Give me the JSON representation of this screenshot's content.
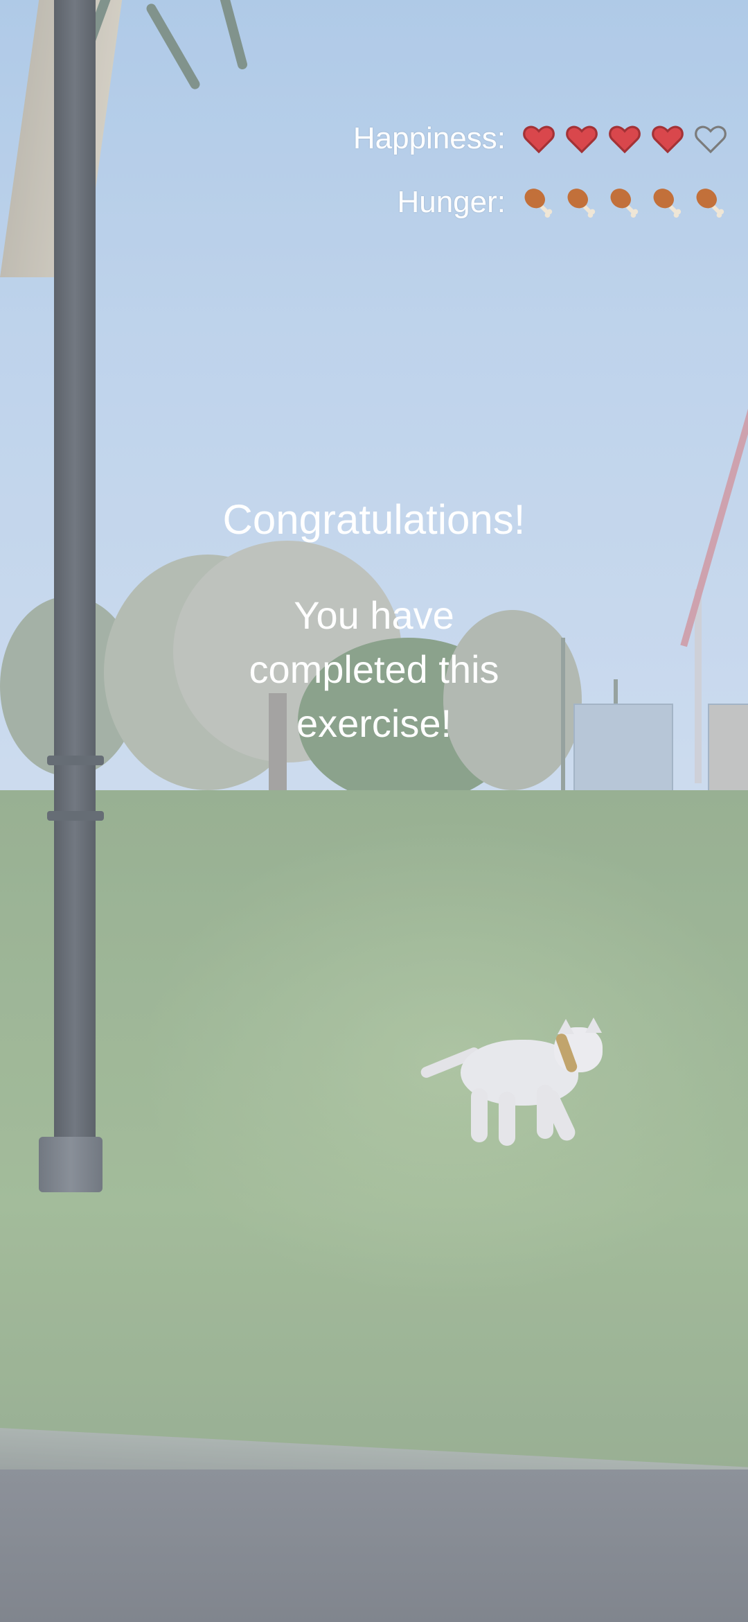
{
  "hud": {
    "happiness": {
      "label": "Happiness:",
      "icon": "heart-icon",
      "value": 4,
      "max": 5
    },
    "hunger": {
      "label": "Hunger:",
      "icon": "drumstick-icon",
      "value": 5,
      "max": 5
    }
  },
  "message": {
    "title": "Congratulations!",
    "body": "You have completed this exercise!"
  },
  "colors": {
    "heart_filled": "#d9474c",
    "heart_empty": "#7b7b7b",
    "drumstick": "#c2703a",
    "text": "#ffffff"
  }
}
